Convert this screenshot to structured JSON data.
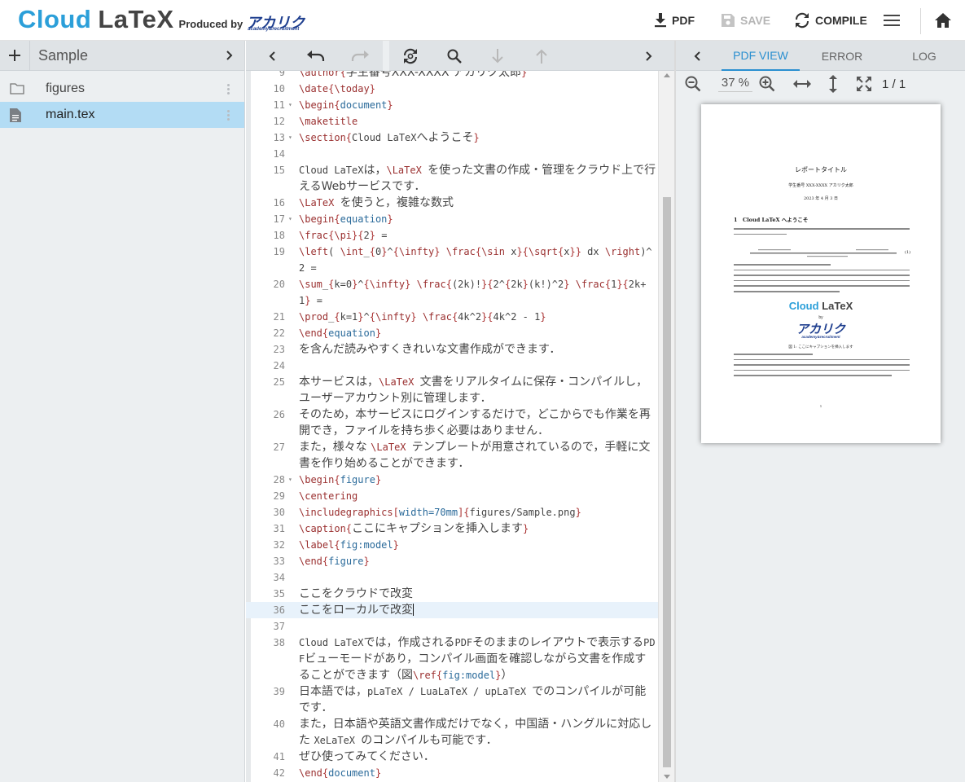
{
  "header": {
    "brand_cloud": "Cloud",
    "brand_latex": "LaTeX",
    "produced_by": "Produced by",
    "partner_logo": "アカリク",
    "partner_sub": "academy&recruitment",
    "pdf_label": "PDF",
    "save_label": "SAVE",
    "compile_label": "COMPILE"
  },
  "sidebar": {
    "project_name": "Sample",
    "items": [
      {
        "label": "figures",
        "type": "folder",
        "selected": false
      },
      {
        "label": "main.tex",
        "type": "file",
        "selected": true
      }
    ]
  },
  "editor": {
    "current_line": "36",
    "lines": [
      {
        "num": "9",
        "fold": "",
        "html": "<span class=\"cmd\">\\author</span><span class=\"brc\">{</span><span class=\"jp\">学生番号XXX-XXXX アカリク太郎</span><span class=\"brc\">}</span>"
      },
      {
        "num": "10",
        "fold": "",
        "html": "<span class=\"cmd\">\\date</span><span class=\"brc\">{</span><span class=\"cmd\">\\today</span><span class=\"brc\">}</span>"
      },
      {
        "num": "11",
        "fold": "▾",
        "html": "<span class=\"cmd\">\\begin</span><span class=\"brc\">{</span><span class=\"arg\">document</span><span class=\"brc\">}</span>"
      },
      {
        "num": "12",
        "fold": "",
        "html": "<span class=\"cmd\">\\maketitle</span>"
      },
      {
        "num": "13",
        "fold": "▾",
        "html": "<span class=\"cmd\">\\section</span><span class=\"brc\">{</span>Cloud LaTeX<span class=\"jp\">へようこそ</span><span class=\"brc\">}</span>"
      },
      {
        "num": "14",
        "fold": "",
        "html": ""
      },
      {
        "num": "15",
        "fold": "",
        "html": "Cloud LaTeX<span class=\"jp\">は，</span><span class=\"cmd\">\\LaTeX</span> <span class=\"jp\">を使った文書の作成・管理をクラウド上で行えるWebサービスです．</span>"
      },
      {
        "num": "16",
        "fold": "",
        "html": "<span class=\"cmd\">\\LaTeX</span> <span class=\"jp\">を使うと，複雑な数式</span>"
      },
      {
        "num": "17",
        "fold": "▾",
        "html": "<span class=\"cmd\">\\begin</span><span class=\"brc\">{</span><span class=\"arg\">equation</span><span class=\"brc\">}</span>"
      },
      {
        "num": "18",
        "fold": "",
        "html": "<span class=\"cmd\">\\frac</span><span class=\"brc\">{</span><span class=\"cmd\">\\pi</span><span class=\"brc\">}{</span>2<span class=\"brc\">}</span> ="
      },
      {
        "num": "19",
        "fold": "",
        "html": "<span class=\"cmd\">\\left</span>( <span class=\"cmd\">\\int</span>_<span class=\"brc\">{</span>0<span class=\"brc\">}</span>^<span class=\"brc\">{</span><span class=\"cmd\">\\infty</span><span class=\"brc\">}</span> <span class=\"cmd\">\\frac</span><span class=\"brc\">{</span><span class=\"cmd\">\\sin</span> x<span class=\"brc\">}{</span><span class=\"cmd\">\\sqrt</span><span class=\"brc\">{</span>x<span class=\"brc\">}}</span> dx <span class=\"cmd\">\\right</span>)^2 ="
      },
      {
        "num": "20",
        "fold": "",
        "html": "<span class=\"cmd\">\\sum</span>_<span class=\"brc\">{</span>k=0<span class=\"brc\">}</span>^<span class=\"brc\">{</span><span class=\"cmd\">\\infty</span><span class=\"brc\">}</span> <span class=\"cmd\">\\frac</span><span class=\"brc\">{</span>(2k)!<span class=\"brc\">}{</span>2^<span class=\"brc\">{</span>2k<span class=\"brc\">}</span>(k!)^2<span class=\"brc\">}</span> <span class=\"cmd\">\\frac</span><span class=\"brc\">{</span>1<span class=\"brc\">}{</span>2k+1<span class=\"brc\">}</span> ="
      },
      {
        "num": "21",
        "fold": "",
        "html": "<span class=\"cmd\">\\prod</span>_<span class=\"brc\">{</span>k=1<span class=\"brc\">}</span>^<span class=\"brc\">{</span><span class=\"cmd\">\\infty</span><span class=\"brc\">}</span> <span class=\"cmd\">\\frac</span><span class=\"brc\">{</span>4k^2<span class=\"brc\">}{</span>4k^2 - 1<span class=\"brc\">}</span>"
      },
      {
        "num": "22",
        "fold": "",
        "html": "<span class=\"cmd\">\\end</span><span class=\"brc\">{</span><span class=\"arg\">equation</span><span class=\"brc\">}</span>"
      },
      {
        "num": "23",
        "fold": "",
        "html": "<span class=\"jp\">を含んだ読みやすくきれいな文書作成ができます．</span>"
      },
      {
        "num": "24",
        "fold": "",
        "html": ""
      },
      {
        "num": "25",
        "fold": "",
        "html": "<span class=\"jp\">本サービスは，</span><span class=\"cmd\">\\LaTeX</span> <span class=\"jp\">文書をリアルタイムに保存・コンパイルし，ユーザーアカウント別に管理します．</span>"
      },
      {
        "num": "26",
        "fold": "",
        "html": "<span class=\"jp\">そのため，本サービスにログインするだけで，どこからでも作業を再開でき，ファイルを持ち歩く必要はありません．</span>"
      },
      {
        "num": "27",
        "fold": "",
        "html": "<span class=\"jp\">また，様々な </span><span class=\"cmd\">\\LaTeX</span> <span class=\"jp\">テンプレートが用意されているので，手軽に文書を作り始めることができます．</span>"
      },
      {
        "num": "28",
        "fold": "▾",
        "html": "<span class=\"cmd\">\\begin</span><span class=\"brc\">{</span><span class=\"arg\">figure</span><span class=\"brc\">}</span>"
      },
      {
        "num": "29",
        "fold": "",
        "html": "<span class=\"cmd\">\\centering</span>"
      },
      {
        "num": "30",
        "fold": "",
        "html": "<span class=\"cmd\">\\includegraphics</span><span class=\"brc\">[</span><span class=\"arg\">width=70mm</span><span class=\"brc\">]{</span>figures/Sample.png<span class=\"brc\">}</span>"
      },
      {
        "num": "31",
        "fold": "",
        "html": "<span class=\"cmd\">\\caption</span><span class=\"brc\">{</span><span class=\"jp\">ここにキャプションを挿入します</span><span class=\"brc\">}</span>"
      },
      {
        "num": "32",
        "fold": "",
        "html": "<span class=\"cmd\">\\label</span><span class=\"brc\">{</span><span class=\"arg\">fig:model</span><span class=\"brc\">}</span>"
      },
      {
        "num": "33",
        "fold": "",
        "html": "<span class=\"cmd\">\\end</span><span class=\"brc\">{</span><span class=\"arg\">figure</span><span class=\"brc\">}</span>"
      },
      {
        "num": "34",
        "fold": "",
        "html": ""
      },
      {
        "num": "35",
        "fold": "",
        "html": "<span class=\"jp\">ここをクラウドで改変</span>"
      },
      {
        "num": "36",
        "fold": "",
        "html": "<span class=\"jp\">ここをローカルで改変</span><span id=\"caret\"></span>"
      },
      {
        "num": "37",
        "fold": "",
        "html": ""
      },
      {
        "num": "38",
        "fold": "",
        "html": "Cloud LaTeX<span class=\"jp\">では，作成される</span>PDF<span class=\"jp\">そのままのレイアウトで表示する</span>PDF<span class=\"jp\">ビューモードがあり，コンパイル画面を確認しながら文書を作成することができます（図</span><span class=\"cmd\">\\ref</span><span class=\"brc\">{</span><span class=\"arg\">fig:model</span><span class=\"brc\">}</span><span class=\"jp\">）</span>"
      },
      {
        "num": "39",
        "fold": "",
        "html": "<span class=\"jp\">日本語では，</span>pLaTeX / LuaLaTeX / upLaTeX <span class=\"jp\">でのコンパイルが可能です．</span>"
      },
      {
        "num": "40",
        "fold": "",
        "html": "<span class=\"jp\">また，日本語や英語文書作成だけでなく，中国語・ハングルに対応した </span>XeLaTeX <span class=\"jp\">のコンパイルも可能です．</span>"
      },
      {
        "num": "41",
        "fold": "",
        "html": "<span class=\"jp\">ぜひ使ってみてください．</span>"
      },
      {
        "num": "42",
        "fold": "",
        "html": "<span class=\"cmd\">\\end</span><span class=\"brc\">{</span><span class=\"arg\">document</span><span class=\"brc\">}</span>"
      }
    ]
  },
  "preview": {
    "tabs": [
      "PDF VIEW",
      "ERROR",
      "LOG"
    ],
    "active_tab": "PDF VIEW",
    "zoom": "37 %",
    "page_indicator": "1 / 1",
    "page": {
      "title": "レポートタイトル",
      "author": "学生番号 XXX-XXXX アカリク太郎",
      "date": "2023 年 4 月 3 日",
      "section": "1　Cloud LaTeX へようこそ",
      "logo_cloud": "Cloud",
      "logo_latex": "LaTeX",
      "logo_by": "by",
      "logo_aka": "アカリク",
      "logo_sub": "academy&recruitment",
      "caption": "図 1: ここにキャプションを挿入します",
      "eq_number": "(1)",
      "page_number": "1"
    }
  }
}
